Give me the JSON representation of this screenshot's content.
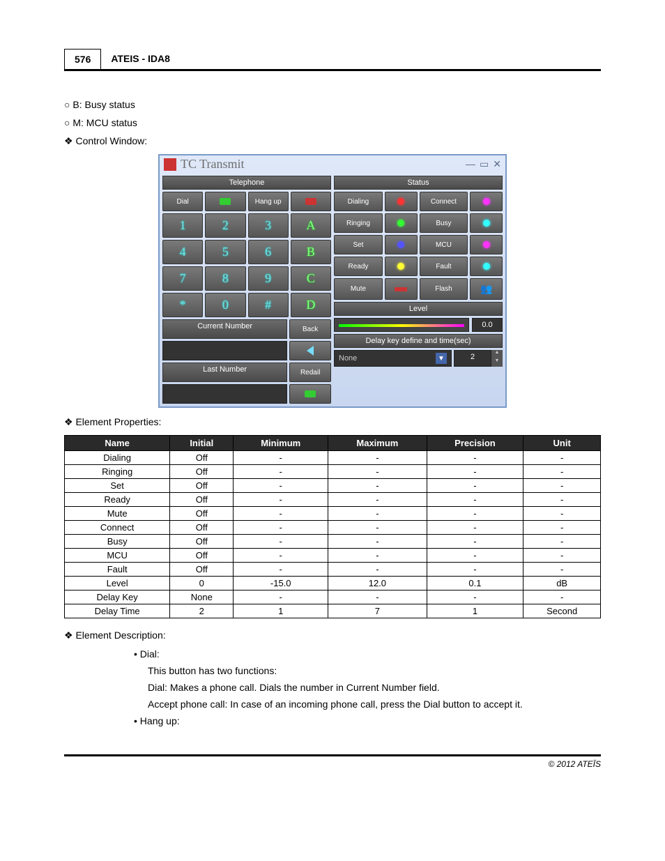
{
  "header": {
    "page_num": "576",
    "title": "ATEIS - IDA8"
  },
  "bullets": {
    "b_status": "B: Busy status",
    "m_status": "M: MCU status",
    "control_window": "Control Window:",
    "element_properties": "Element Properties:",
    "element_description": "Element Description:"
  },
  "win": {
    "title": "TC Transmit",
    "telephone": "Telephone",
    "status": "Status",
    "dial": "Dial",
    "hangup": "Hang up",
    "keys": [
      "1",
      "2",
      "3",
      "A",
      "4",
      "5",
      "6",
      "B",
      "7",
      "8",
      "9",
      "C",
      "*",
      "0",
      "#",
      "D"
    ],
    "status_items": [
      "Dialing",
      "Connect",
      "Ringing",
      "Busy",
      "Set",
      "MCU",
      "Ready",
      "Fault",
      "Mute",
      "Flash"
    ],
    "current_number": "Current Number",
    "back": "Back",
    "last_number": "Last Number",
    "redail": "Redail",
    "level": "Level",
    "level_val": "0.0",
    "delay_label": "Delay key define and time(sec)",
    "delay_key": "None",
    "delay_time": "2"
  },
  "props": {
    "headers": [
      "Name",
      "Initial",
      "Minimum",
      "Maximum",
      "Precision",
      "Unit"
    ],
    "rows": [
      [
        "Dialing",
        "Off",
        "-",
        "-",
        "-",
        "-"
      ],
      [
        "Ringing",
        "Off",
        "-",
        "-",
        "-",
        "-"
      ],
      [
        "Set",
        "Off",
        "-",
        "-",
        "-",
        "-"
      ],
      [
        "Ready",
        "Off",
        "-",
        "-",
        "-",
        "-"
      ],
      [
        "Mute",
        "Off",
        "-",
        "-",
        "-",
        "-"
      ],
      [
        "Connect",
        "Off",
        "-",
        "-",
        "-",
        "-"
      ],
      [
        "Busy",
        "Off",
        "-",
        "-",
        "-",
        "-"
      ],
      [
        "MCU",
        "Off",
        "-",
        "-",
        "-",
        "-"
      ],
      [
        "Fault",
        "Off",
        "-",
        "-",
        "-",
        "-"
      ],
      [
        "Level",
        "0",
        "-15.0",
        "12.0",
        "0.1",
        "dB"
      ],
      [
        "Delay Key",
        "None",
        "-",
        "-",
        "-",
        "-"
      ],
      [
        "Delay Time",
        "2",
        "1",
        "7",
        "1",
        "Second"
      ]
    ]
  },
  "desc": {
    "dial_label": "Dial:",
    "dial_intro": "This button has two functions:",
    "dial_1": "Dial: Makes a phone call. Dials the number in Current Number field.",
    "dial_2": "Accept phone call: In case of an incoming phone call, press the Dial button to accept it.",
    "hangup_label": "Hang up:"
  },
  "footer": "© 2012 ATEÏS"
}
